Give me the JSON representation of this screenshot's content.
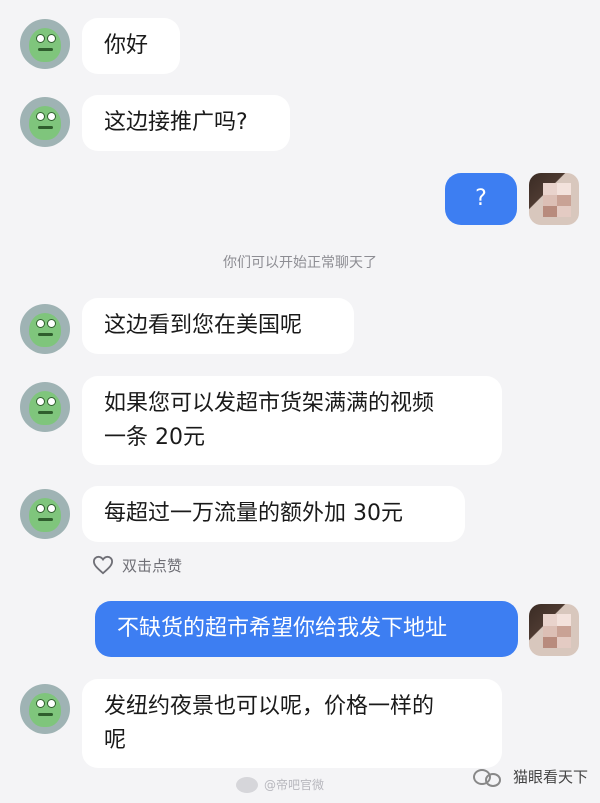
{
  "messages": [
    {
      "text": "你好"
    },
    {
      "text": "这边接推广吗?"
    },
    {
      "text": "?"
    },
    {
      "text": "这边看到您在美国呢"
    },
    {
      "line1": "如果您可以发超市货架满满的视频",
      "line2": "一条 20元"
    },
    {
      "text": "每超过一万流量的额外加 30元"
    },
    {
      "text": "不缺货的超市希望你给我发下地址"
    },
    {
      "line1": "发纽约夜景也可以呢，价格一样的",
      "line2": "呢"
    }
  ],
  "system_notice": "你们可以开始正常聊天了",
  "like": {
    "label": "双击点赞",
    "icon": "heart-outline-icon"
  },
  "watermark": {
    "weibo": "@帝吧官微",
    "wechat": "猫眼看天下"
  },
  "colors": {
    "user_bubble": "#3d7ef2",
    "other_bubble": "#ffffff",
    "background": "#f4f4f6"
  }
}
